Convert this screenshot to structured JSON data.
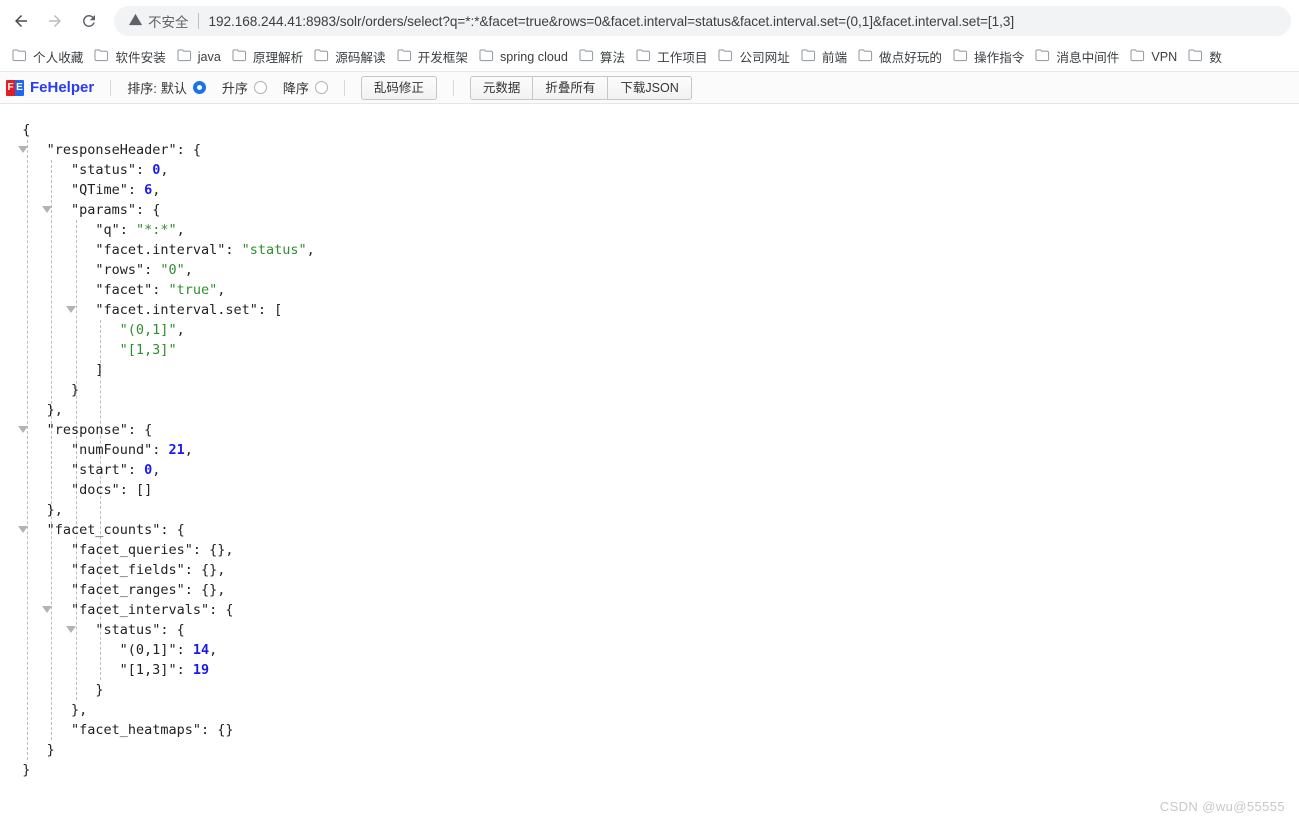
{
  "browser": {
    "back_label": "back-arrow",
    "forward_label": "forward-arrow",
    "reload_label": "reload",
    "security_text": "不安全",
    "url": "192.168.244.41:8983/solr/orders/select?q=*:*&facet=true&rows=0&facet.interval=status&facet.interval.set=(0,1]&facet.interval.set=[1,3]",
    "bookmarks": [
      {
        "label": "个人收藏"
      },
      {
        "label": "软件安装"
      },
      {
        "label": "java"
      },
      {
        "label": "原理解析"
      },
      {
        "label": "源码解读"
      },
      {
        "label": "开发框架"
      },
      {
        "label": "spring cloud"
      },
      {
        "label": "算法"
      },
      {
        "label": "工作项目"
      },
      {
        "label": "公司网址"
      },
      {
        "label": "前端"
      },
      {
        "label": "做点好玩的"
      },
      {
        "label": "操作指令"
      },
      {
        "label": "消息中间件"
      },
      {
        "label": "VPN"
      },
      {
        "label": "数"
      }
    ]
  },
  "fehelper": {
    "logo_f": "F",
    "logo_e": "E",
    "logo_text": "FeHelper",
    "sort_label": "排序:",
    "sort_options": [
      {
        "label": "默认",
        "checked": true
      },
      {
        "label": "升序",
        "checked": false
      },
      {
        "label": "降序",
        "checked": false
      }
    ],
    "fix_encoding_label": "乱码修正",
    "metadata_label": "元数据",
    "collapse_all_label": "折叠所有",
    "download_json_label": "下载JSON"
  },
  "json_lines": [
    {
      "indent": 0,
      "tri": false,
      "parts": [
        {
          "t": "p",
          "v": "{"
        }
      ]
    },
    {
      "indent": 1,
      "tri": true,
      "parts": [
        {
          "t": "k",
          "v": "\"responseHeader\""
        },
        {
          "t": "p",
          "v": ": {"
        }
      ]
    },
    {
      "indent": 2,
      "tri": false,
      "parts": [
        {
          "t": "k",
          "v": "\"status\""
        },
        {
          "t": "p",
          "v": ": "
        },
        {
          "t": "n",
          "v": "0"
        },
        {
          "t": "p",
          "v": ","
        }
      ]
    },
    {
      "indent": 2,
      "tri": false,
      "parts": [
        {
          "t": "k",
          "v": "\"QTime\""
        },
        {
          "t": "p",
          "v": ": "
        },
        {
          "t": "n",
          "v": "6"
        },
        {
          "t": "p",
          "v": ","
        }
      ]
    },
    {
      "indent": 2,
      "tri": true,
      "parts": [
        {
          "t": "k",
          "v": "\"params\""
        },
        {
          "t": "p",
          "v": ": {"
        }
      ]
    },
    {
      "indent": 3,
      "tri": false,
      "parts": [
        {
          "t": "k",
          "v": "\"q\""
        },
        {
          "t": "p",
          "v": ": "
        },
        {
          "t": "s",
          "v": "\"*:*\""
        },
        {
          "t": "p",
          "v": ","
        }
      ]
    },
    {
      "indent": 3,
      "tri": false,
      "parts": [
        {
          "t": "k",
          "v": "\"facet.interval\""
        },
        {
          "t": "p",
          "v": ": "
        },
        {
          "t": "s",
          "v": "\"status\""
        },
        {
          "t": "p",
          "v": ","
        }
      ]
    },
    {
      "indent": 3,
      "tri": false,
      "parts": [
        {
          "t": "k",
          "v": "\"rows\""
        },
        {
          "t": "p",
          "v": ": "
        },
        {
          "t": "s",
          "v": "\"0\""
        },
        {
          "t": "p",
          "v": ","
        }
      ]
    },
    {
      "indent": 3,
      "tri": false,
      "parts": [
        {
          "t": "k",
          "v": "\"facet\""
        },
        {
          "t": "p",
          "v": ": "
        },
        {
          "t": "s",
          "v": "\"true\""
        },
        {
          "t": "p",
          "v": ","
        }
      ]
    },
    {
      "indent": 3,
      "tri": true,
      "parts": [
        {
          "t": "k",
          "v": "\"facet.interval.set\""
        },
        {
          "t": "p",
          "v": ": ["
        }
      ]
    },
    {
      "indent": 4,
      "tri": false,
      "parts": [
        {
          "t": "s",
          "v": "\"(0,1]\""
        },
        {
          "t": "p",
          "v": ","
        }
      ]
    },
    {
      "indent": 4,
      "tri": false,
      "parts": [
        {
          "t": "s",
          "v": "\"[1,3]\""
        }
      ]
    },
    {
      "indent": 3,
      "tri": false,
      "parts": [
        {
          "t": "p",
          "v": "]"
        }
      ]
    },
    {
      "indent": 2,
      "tri": false,
      "parts": [
        {
          "t": "p",
          "v": "}"
        }
      ]
    },
    {
      "indent": 1,
      "tri": false,
      "parts": [
        {
          "t": "p",
          "v": "},"
        }
      ]
    },
    {
      "indent": 1,
      "tri": true,
      "parts": [
        {
          "t": "k",
          "v": "\"response\""
        },
        {
          "t": "p",
          "v": ": {"
        }
      ]
    },
    {
      "indent": 2,
      "tri": false,
      "parts": [
        {
          "t": "k",
          "v": "\"numFound\""
        },
        {
          "t": "p",
          "v": ": "
        },
        {
          "t": "n",
          "v": "21"
        },
        {
          "t": "p",
          "v": ","
        }
      ]
    },
    {
      "indent": 2,
      "tri": false,
      "parts": [
        {
          "t": "k",
          "v": "\"start\""
        },
        {
          "t": "p",
          "v": ": "
        },
        {
          "t": "n",
          "v": "0"
        },
        {
          "t": "p",
          "v": ","
        }
      ]
    },
    {
      "indent": 2,
      "tri": false,
      "parts": [
        {
          "t": "k",
          "v": "\"docs\""
        },
        {
          "t": "p",
          "v": ": []"
        }
      ]
    },
    {
      "indent": 1,
      "tri": false,
      "parts": [
        {
          "t": "p",
          "v": "},"
        }
      ]
    },
    {
      "indent": 1,
      "tri": true,
      "parts": [
        {
          "t": "k",
          "v": "\"facet_counts\""
        },
        {
          "t": "p",
          "v": ": {"
        }
      ]
    },
    {
      "indent": 2,
      "tri": false,
      "parts": [
        {
          "t": "k",
          "v": "\"facet_queries\""
        },
        {
          "t": "p",
          "v": ": {},"
        }
      ]
    },
    {
      "indent": 2,
      "tri": false,
      "parts": [
        {
          "t": "k",
          "v": "\"facet_fields\""
        },
        {
          "t": "p",
          "v": ": {},"
        }
      ]
    },
    {
      "indent": 2,
      "tri": false,
      "parts": [
        {
          "t": "k",
          "v": "\"facet_ranges\""
        },
        {
          "t": "p",
          "v": ": {},"
        }
      ]
    },
    {
      "indent": 2,
      "tri": true,
      "parts": [
        {
          "t": "k",
          "v": "\"facet_intervals\""
        },
        {
          "t": "p",
          "v": ": {"
        }
      ]
    },
    {
      "indent": 3,
      "tri": true,
      "parts": [
        {
          "t": "k",
          "v": "\"status\""
        },
        {
          "t": "p",
          "v": ": {"
        }
      ]
    },
    {
      "indent": 4,
      "tri": false,
      "parts": [
        {
          "t": "k",
          "v": "\"(0,1]\""
        },
        {
          "t": "p",
          "v": ": "
        },
        {
          "t": "n",
          "v": "14"
        },
        {
          "t": "p",
          "v": ","
        }
      ]
    },
    {
      "indent": 4,
      "tri": false,
      "parts": [
        {
          "t": "k",
          "v": "\"[1,3]\""
        },
        {
          "t": "p",
          "v": ": "
        },
        {
          "t": "n",
          "v": "19"
        }
      ]
    },
    {
      "indent": 3,
      "tri": false,
      "parts": [
        {
          "t": "p",
          "v": "}"
        }
      ]
    },
    {
      "indent": 2,
      "tri": false,
      "parts": [
        {
          "t": "p",
          "v": "},"
        }
      ]
    },
    {
      "indent": 2,
      "tri": false,
      "parts": [
        {
          "t": "k",
          "v": "\"facet_heatmaps\""
        },
        {
          "t": "p",
          "v": ": {}"
        }
      ]
    },
    {
      "indent": 1,
      "tri": false,
      "parts": [
        {
          "t": "p",
          "v": "}"
        }
      ]
    },
    {
      "indent": 0,
      "tri": false,
      "parts": [
        {
          "t": "p",
          "v": "}"
        }
      ]
    }
  ],
  "watermark": "CSDN @wu@55555"
}
